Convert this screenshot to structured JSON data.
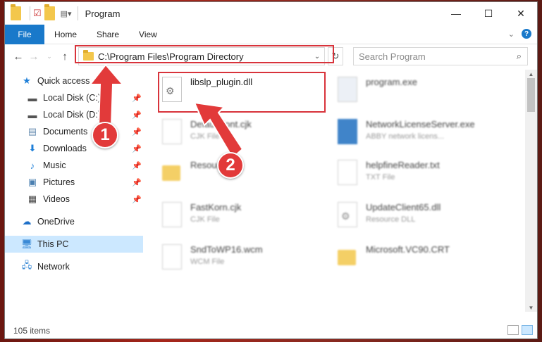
{
  "window": {
    "title": "Program"
  },
  "ribbon": {
    "tabs": [
      "File",
      "Home",
      "Share",
      "View"
    ]
  },
  "address": {
    "path": "C:\\Program Files\\Program Directory"
  },
  "search": {
    "placeholder": "Search Program"
  },
  "sidebar": {
    "items": [
      {
        "label": "Quick access",
        "icon": "star-icon"
      },
      {
        "label": "Local Disk (C:)",
        "icon": "drive-icon"
      },
      {
        "label": "Local Disk (D:)",
        "icon": "drive-icon"
      },
      {
        "label": "Documents",
        "icon": "documents-icon"
      },
      {
        "label": "Downloads",
        "icon": "download-icon"
      },
      {
        "label": "Music",
        "icon": "music-icon"
      },
      {
        "label": "Pictures",
        "icon": "pictures-icon"
      },
      {
        "label": "Videos",
        "icon": "videos-icon"
      },
      {
        "label": "OneDrive",
        "icon": "cloud-icon"
      },
      {
        "label": "This PC",
        "icon": "computer-icon"
      },
      {
        "label": "Network",
        "icon": "network-icon"
      }
    ]
  },
  "files": [
    {
      "name": "libslp_plugin.dll",
      "type": ""
    },
    {
      "name": "program.exe",
      "type": ""
    },
    {
      "name": "DefaultFont.cjk",
      "type": "CJK File"
    },
    {
      "name": "NetworkLicenseServer.exe",
      "type": "ABBY network licens..."
    },
    {
      "name": "Resources",
      "type": ""
    },
    {
      "name": "helpfineReader.txt",
      "type": "TXT File"
    },
    {
      "name": "FastKorn.cjk",
      "type": "CJK File"
    },
    {
      "name": "UpdateClient65.dll",
      "type": "Resource DLL"
    },
    {
      "name": "SndToWP16.wcm",
      "type": "WCM File"
    },
    {
      "name": "Microsoft.VC90.CRT",
      "type": ""
    }
  ],
  "status": {
    "count": "105 items"
  },
  "annotations": {
    "step1": "1",
    "step2": "2",
    "color": "#d8333b"
  }
}
